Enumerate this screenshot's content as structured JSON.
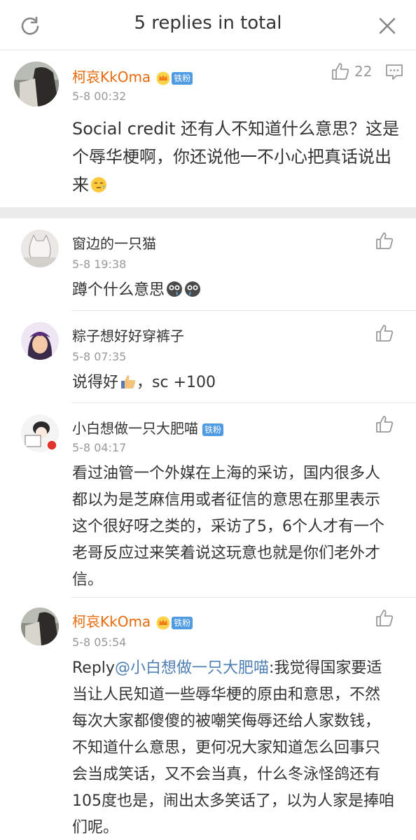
{
  "header": {
    "title": "5 replies in total",
    "refresh_icon": "refresh-icon",
    "close_icon": "close-icon"
  },
  "main_comment": {
    "author": "柯哀KkOma",
    "badge": "铁粉",
    "time": "5-8 00:32",
    "likes": "22",
    "text": "Social credit 还有人不知道什么意思？这是个辱华梗啊，你还说他一不小心把真话说出来"
  },
  "replies": [
    {
      "author": "窗边的一只猫",
      "time": "5-8 19:38",
      "text": "蹲个什么意思"
    },
    {
      "author": "粽子想好好穿裤子",
      "time": "5-8 07:35",
      "text_before": "说得好",
      "text_after": "，sc +100"
    },
    {
      "author": "小白想做一只大肥喵",
      "badge": "铁粉",
      "time": "5-8 04:17",
      "text": "看过油管一个外媒在上海的采访，国内很多人都以为是芝麻信用或者征信的意思在那里表示这个很好呀之类的，采访了5，6个人才有一个老哥反应过来笑着说这玩意也就是你们老外才信。"
    },
    {
      "author": "柯哀KkOma",
      "badge": "铁粉",
      "time": "5-8 05:54",
      "reply_prefix": "Reply",
      "mention": "@小白想做一只大肥喵",
      "text": ":我觉得国家要适当让人民知道一些辱华梗的原由和意思，不然每次大家都傻傻的被嘲笑侮辱还给人家数钱，不知道什么意思，更何况大家知道怎么回事只会当成笑话，又不会当真，什么冬泳怪鸽还有105度也是，闹出太多笑话了，以为人家是捧咱们呢。"
    }
  ],
  "colors": {
    "username_vip": "#e86a0c",
    "badge": "#4f9be3",
    "mention": "#4e7fb3",
    "divider": "#ececec"
  }
}
